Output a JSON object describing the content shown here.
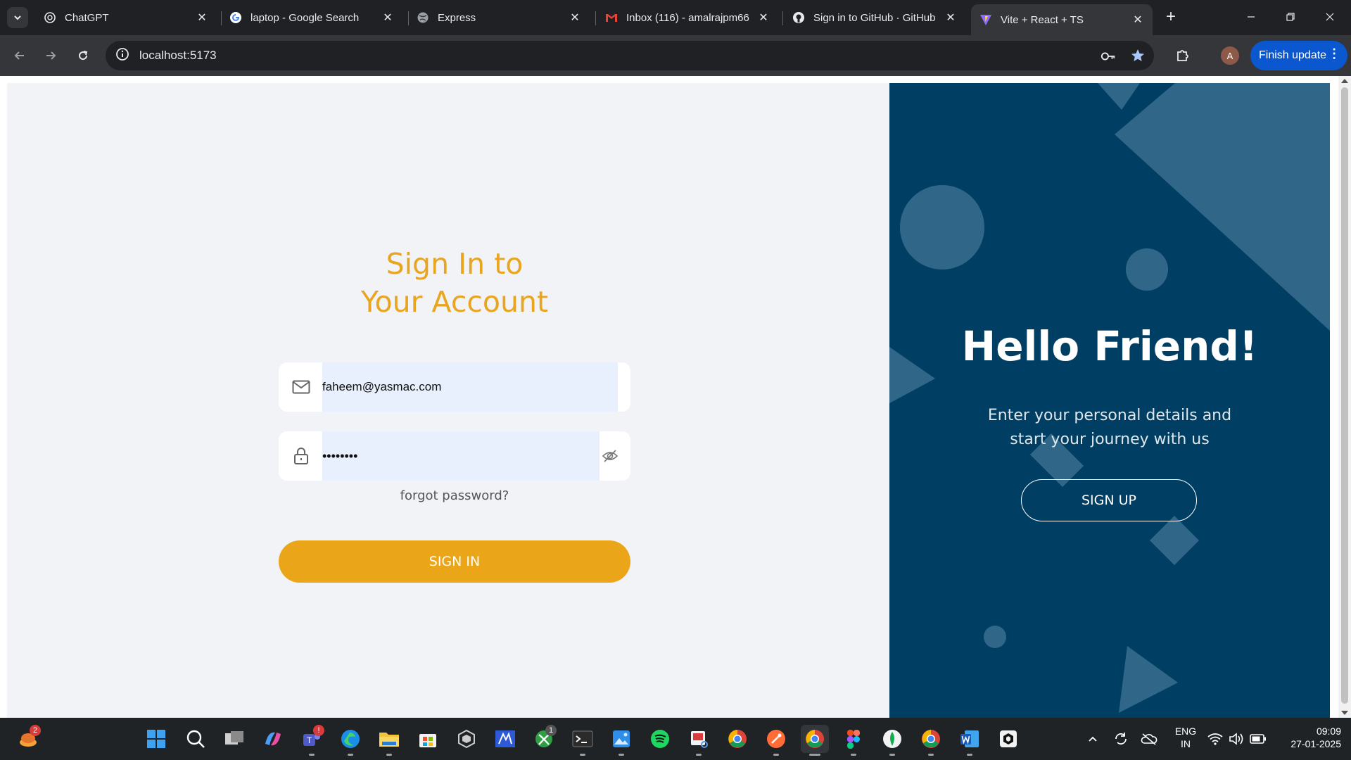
{
  "browser": {
    "tabs": [
      {
        "title": "ChatGPT",
        "favicon": "chatgpt-icon"
      },
      {
        "title": "laptop - Google Search",
        "favicon": "google-icon"
      },
      {
        "title": "Express",
        "favicon": "globe-icon"
      },
      {
        "title": "Inbox (116) - amalrajpm66",
        "favicon": "gmail-icon"
      },
      {
        "title": "Sign in to GitHub · GitHub",
        "favicon": "github-icon"
      },
      {
        "title": "Vite + React + TS",
        "favicon": "vite-icon"
      }
    ],
    "active_tab": 5,
    "url": "localhost:5173",
    "profile_initial": "A",
    "update_button": "Finish update"
  },
  "signin": {
    "heading_line1": "Sign In to",
    "heading_line2": "Your Account",
    "email_value": "faheem@yasmac.com",
    "password_value": "••••••••",
    "forgot_label": "forgot password?",
    "signin_label": "SIGN IN"
  },
  "panel": {
    "title": "Hello Friend!",
    "subtitle_line1": "Enter your personal details and",
    "subtitle_line2": "start your journey with us",
    "signup_label": "SIGN UP"
  },
  "taskbar": {
    "widget_badge": "2",
    "teams_badge": "!",
    "xbox_badge": "1",
    "lang_line1": "ENG",
    "lang_line2": "IN",
    "time": "09:09",
    "date": "27-01-2025"
  },
  "colors": {
    "accent_orange": "#eba519",
    "panel_navy": "#003f63",
    "page_bg": "#f1f3f6",
    "input_fill": "#e8f0fe"
  }
}
